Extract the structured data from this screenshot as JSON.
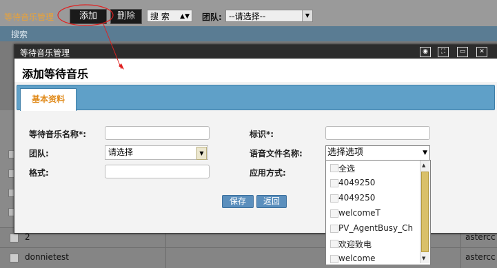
{
  "app": {
    "title": "等待音乐管理",
    "add_label": "添加",
    "delete_label": "删除",
    "search_select": "搜 索",
    "team_label": "团队:",
    "team_select": "--请选择--",
    "search_bar": "搜索"
  },
  "table": {
    "rows": [
      {
        "name": "2",
        "tail": "astercc"
      },
      {
        "name": "donnietest",
        "tail": "astercc"
      }
    ]
  },
  "dialog": {
    "title": "等待音乐管理",
    "heading": "添加等待音乐",
    "tab_label": "基本资料",
    "fields": {
      "name_label": "等待音乐名称*:",
      "id_label": "标识*:",
      "team_label": "团队:",
      "team_value": "请选择",
      "voice_label": "语音文件名称:",
      "voice_value": "选择选项",
      "format_label": "格式:",
      "apply_label": "应用方式:"
    },
    "save_label": "保存",
    "back_label": "返回",
    "voice_options": [
      "全选",
      "4049250",
      "4049250",
      "welcomeT",
      "PV_AgentBusy_Ch",
      "欢迎致电",
      "welcome"
    ]
  },
  "colors": {
    "accent_orange": "#e08a1a",
    "tab_blue": "#5fa0c8",
    "button_blue": "#5b8fbd",
    "annotation_red": "#e02020"
  }
}
